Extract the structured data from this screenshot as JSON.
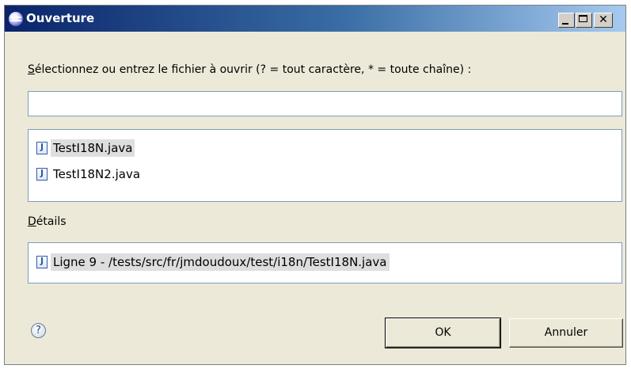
{
  "window": {
    "title": "Ouverture",
    "close_glyph": "✕"
  },
  "prompt": {
    "label": "Sélectionnez ou entrez le fichier à ouvrir (? = tout caractère, * = toute chaîne) :"
  },
  "search": {
    "value": "",
    "placeholder": ""
  },
  "results": {
    "items": [
      {
        "label": "TestI18N.java",
        "icon": "java-file-icon",
        "selected": true
      },
      {
        "label": "TestI18N2.java",
        "icon": "java-file-icon",
        "selected": false
      }
    ]
  },
  "details": {
    "label": "Détails",
    "entry": "Ligne 9 - /tests/src/fr/jmdoudoux/test/i18n/TestI18N.java"
  },
  "footer": {
    "help_glyph": "?",
    "ok_label": "OK",
    "cancel_label": "Annuler"
  }
}
